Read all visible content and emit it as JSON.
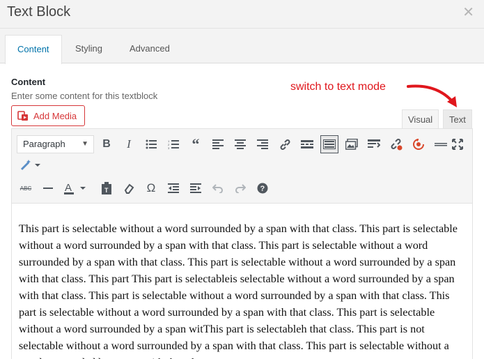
{
  "dialog": {
    "title": "Text Block"
  },
  "tabs": [
    {
      "label": "Content"
    },
    {
      "label": "Styling"
    },
    {
      "label": "Advanced"
    }
  ],
  "field": {
    "label": "Content",
    "description": "Enter some content for this textblock"
  },
  "add_media": {
    "label": "Add Media"
  },
  "annotation": {
    "text": "switch to text mode"
  },
  "editor_tabs": {
    "visual": "Visual",
    "text": "Text"
  },
  "toolbar": {
    "format_select": "Paragraph",
    "special_char": "Ω",
    "strike_label": "ABC"
  },
  "editor": {
    "content": "This part is selectable without a word surrounded by a span with that class. This part is selectable without a word surrounded by a span with that class. This part is selectable without a word surrounded by a span with that class. This part is selectable without a word surrounded by a span with that class. This part This part is selectableis selectable without a word surrounded by a span with that class. This part is selectable without a word surrounded by a span with that class. This part is selectable without a word surrounded by a span with that class. This part is selectable without a word surrounded by a span witThis part is selectableh that class. This part is not selectable without a word surrounded by a span with that class. This part is selectable without a word surrounded by a span with that class."
  },
  "colors": {
    "accent": "#0073aa",
    "danger": "#d63638",
    "annotation": "#e0161c"
  }
}
